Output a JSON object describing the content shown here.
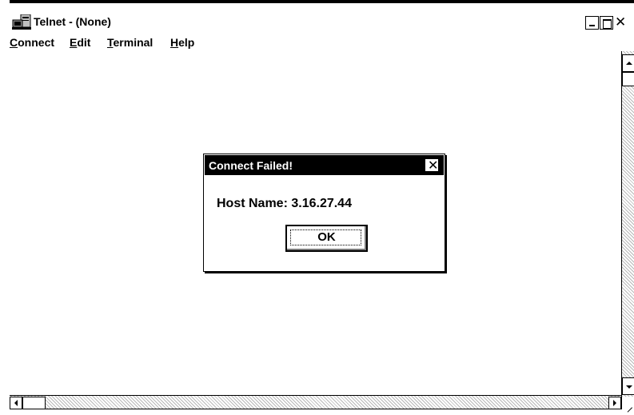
{
  "window": {
    "title": "Telnet - (None)",
    "icon": "telnet-computer-icon",
    "controls": {
      "minimize": "minimize-icon",
      "maximize": "maximize-icon",
      "close": "close-icon"
    }
  },
  "menu": {
    "items": [
      {
        "label": "Connect",
        "underline": "C"
      },
      {
        "label": "Edit",
        "underline": "E"
      },
      {
        "label": "Terminal",
        "underline": "T"
      },
      {
        "label": "Help",
        "underline": "H"
      }
    ]
  },
  "dialog": {
    "title": "Connect Failed!",
    "message": "Host Name: 3.16.27.44",
    "ok_label": "OK",
    "close_icon": "close-icon"
  },
  "scrollbars": {
    "vertical": {
      "up": "arrow-up-icon",
      "down": "arrow-down-icon"
    },
    "horizontal": {
      "left": "arrow-left-icon",
      "right": "arrow-right-icon"
    }
  },
  "colors": {
    "background": "#ffffff",
    "foreground": "#000000",
    "dialog_title_bg": "#000000"
  }
}
